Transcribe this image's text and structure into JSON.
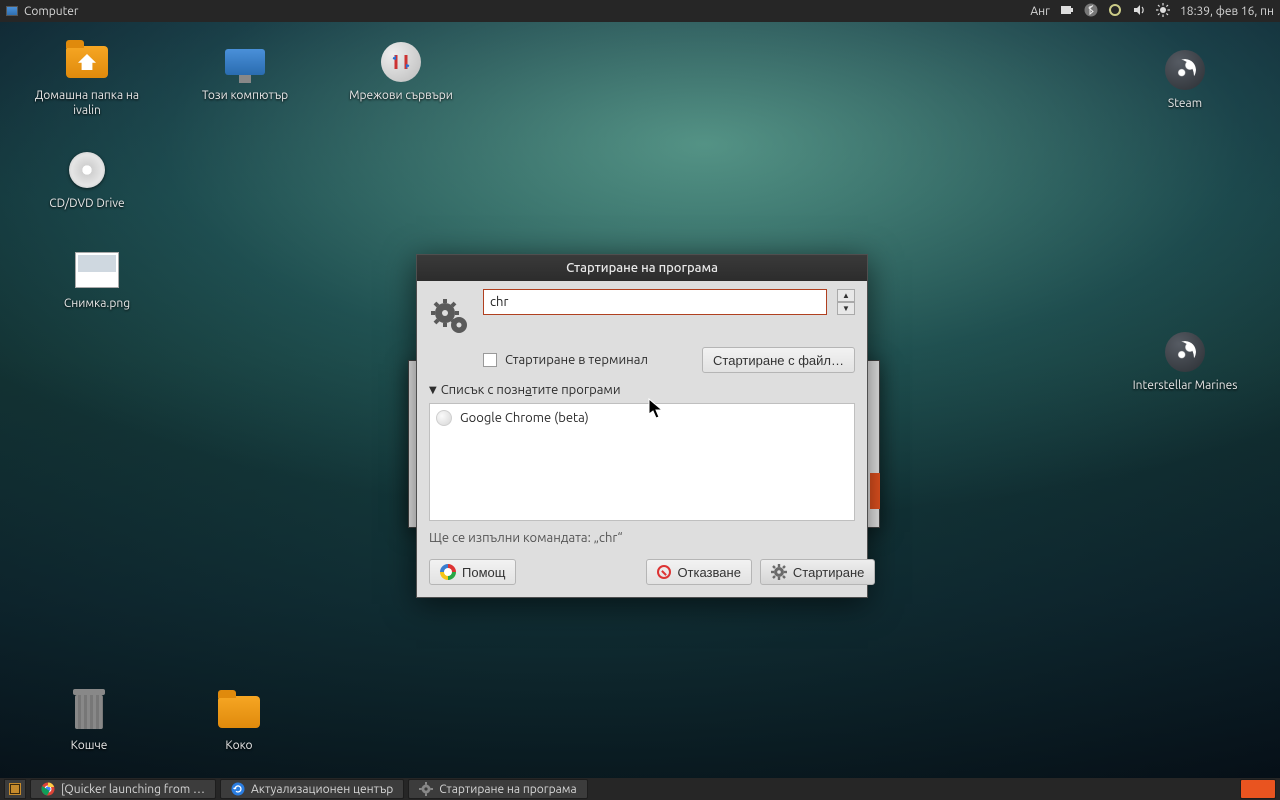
{
  "top_panel": {
    "menu_label": "Computer",
    "lang": "Анг",
    "clock": "18:39, фев 16, пн"
  },
  "desktop": {
    "home": "Домашна папка на ivalin",
    "computer": "Този компютър",
    "network": "Мрежови сървъри",
    "cd": "CD/DVD Drive",
    "screenshot": "Снимка.png",
    "trash": "Кошче",
    "koko": "Коко",
    "steam": "Steam",
    "interstellar": "Interstellar Marines"
  },
  "run_dialog": {
    "title": "Стартиране на програма",
    "input_value": "chr",
    "terminal_checkbox": "Стартиране в терминал",
    "run_file_btn": "Стартиране с файл…",
    "known_programs_label": "Списък с познатите програми",
    "items": [
      {
        "name": "Google Chrome (beta)"
      }
    ],
    "command_line": "Ще се изпълни командата: „chr“",
    "help_btn": "Помощ",
    "cancel_btn": "Отказване",
    "launch_btn": "Стартиране"
  },
  "taskbar": {
    "items": [
      {
        "label": "[Quicker launching from …"
      },
      {
        "label": "Актуализационен център"
      },
      {
        "label": "Стартиране на програма"
      }
    ]
  }
}
